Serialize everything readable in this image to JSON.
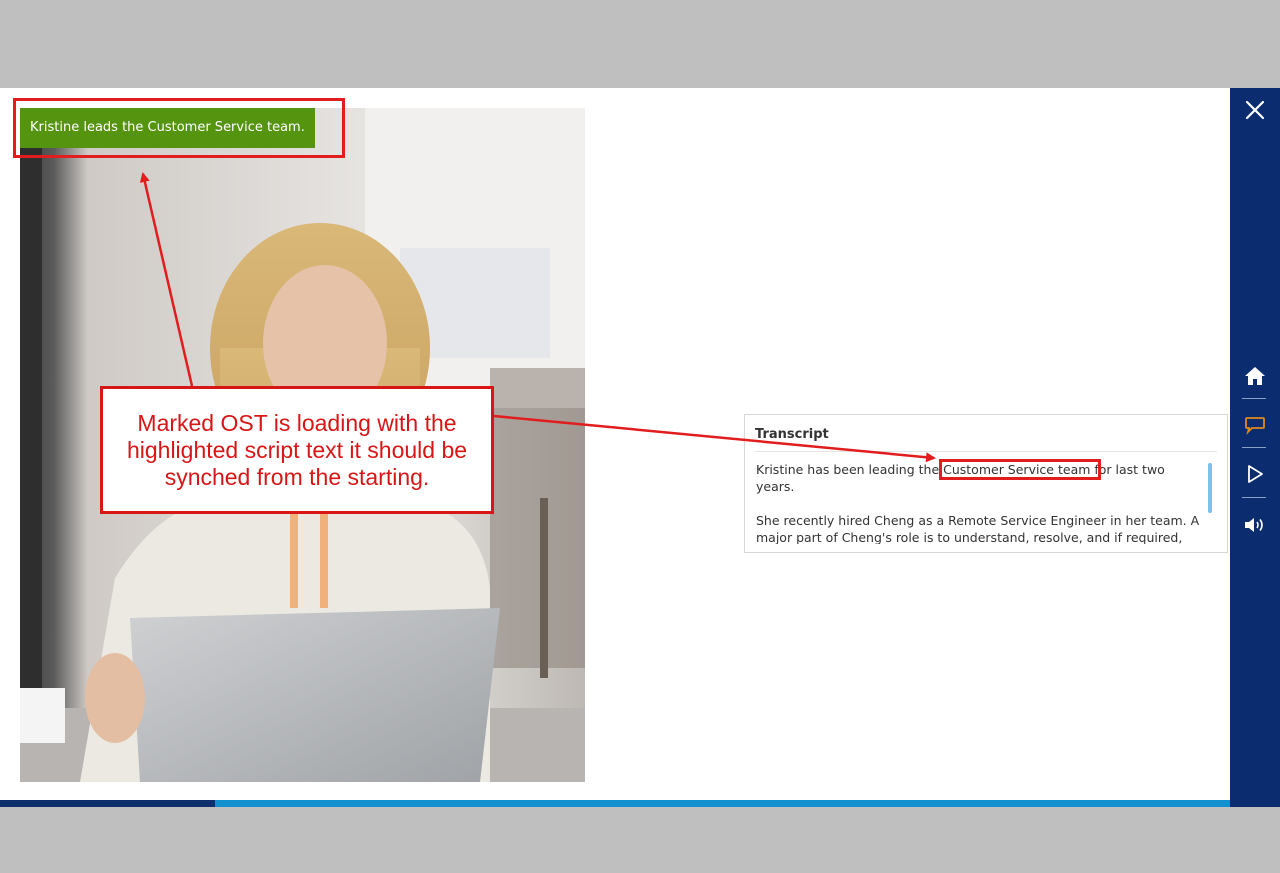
{
  "slide": {
    "onscreen_text": "Kristine leads the Customer Service team."
  },
  "transcript": {
    "title": "Transcript",
    "para1_before": "Kristine has been leading the ",
    "para1_highlight": "Customer Service team",
    "para1_after": " for last two years.",
    "para2": "She recently hired Cheng as a Remote Service Engineer in her team. A major part of Cheng's role is to understand, resolve, and if required, escalate customer issues."
  },
  "sidebar": {
    "items": [
      {
        "icon": "close-icon",
        "label": "Close"
      },
      {
        "icon": "home-icon",
        "label": "Home"
      },
      {
        "icon": "transcript-icon",
        "label": "Transcript",
        "active_color": "#e08a1e"
      },
      {
        "icon": "play-icon",
        "label": "Play"
      },
      {
        "icon": "volume-icon",
        "label": "Volume"
      }
    ]
  },
  "progress": {
    "fraction": 0.175
  },
  "annotation": {
    "callout_text": "Marked OST is loading with the highlighted script text it should be synched from the starting.",
    "color": "#d81616"
  },
  "colors": {
    "ost_bg": "#55940f",
    "sidebar_bg": "#0b2d6f",
    "progress_track": "#1390d0",
    "progress_fill": "#0d2f6e"
  }
}
